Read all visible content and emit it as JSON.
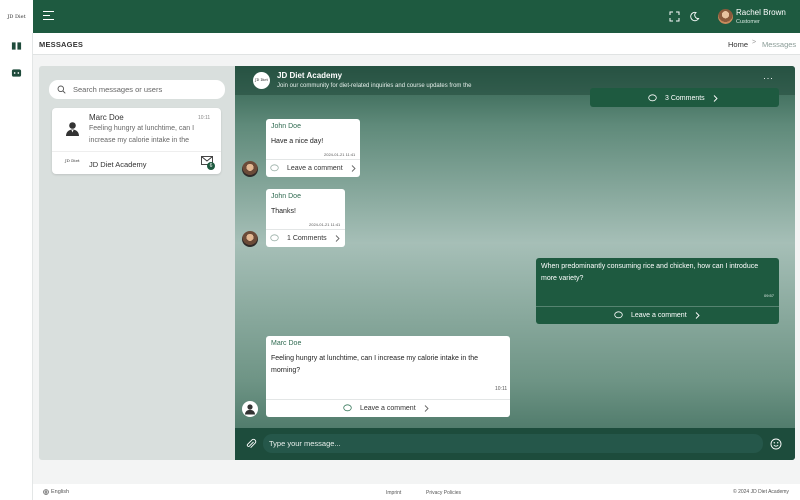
{
  "app": {
    "logo_text": "JD Diet"
  },
  "topbar": {
    "user_name": "Rachel Brown",
    "user_role": "Customer"
  },
  "header": {
    "page_title": "MESSAGES",
    "breadcrumb_home": "Home",
    "breadcrumb_separator": ">",
    "breadcrumb_current": "Messages"
  },
  "search": {
    "placeholder": "Search messages or users"
  },
  "contacts": [
    {
      "name": "Marc Doe",
      "time": "10:11",
      "preview": "Feeling hungry at lunchtime, can I increase my calorie intake in the"
    },
    {
      "name": "JD Diet Academy",
      "unread": "6",
      "logo_text": "JD Diet"
    }
  ],
  "chat": {
    "title": "JD Diet Academy",
    "subtitle": "Join our community for diet-related inquiries and course updates from the",
    "more": "···",
    "logo_text": "JD Diet",
    "messages": [
      {
        "direction": "outgoing",
        "action": "3 Comments"
      },
      {
        "direction": "incoming",
        "sender": "John Doe",
        "text": "Have a nice day!",
        "time": "2024-01-21 11:41",
        "action": "Leave a comment"
      },
      {
        "direction": "incoming",
        "sender": "John Doe",
        "text": "Thanks!",
        "time": "2024-01-21 11:41",
        "action": "1 Comments"
      },
      {
        "direction": "outgoing",
        "text": "When predominantly consuming rice and chicken, how can I introduce more variety?",
        "time": "09:57",
        "action": "Leave a comment"
      },
      {
        "direction": "incoming",
        "sender": "Marc Doe",
        "text": "Feeling hungry at lunchtime, can I increase my calorie intake in the morning?",
        "time": "10:11",
        "action": "Leave a comment"
      }
    ],
    "input_placeholder": "Type your message..."
  },
  "footer": {
    "language": "English",
    "imprint": "Imprint",
    "privacy": "Privacy Policies",
    "copyright": "© 2024 JD Diet Academy"
  },
  "colors": {
    "brand": "#1e5a40",
    "input_bar": "#1d4c3c",
    "panel": "#d9dfdd"
  },
  "icons": [
    "menu-icon",
    "fullscreen-icon",
    "moon-icon",
    "search-icon",
    "book-icon",
    "chat-icon",
    "mail-icon",
    "paperclip-icon",
    "smile-icon",
    "comment-icon",
    "chevron-right-icon",
    "globe-icon"
  ]
}
